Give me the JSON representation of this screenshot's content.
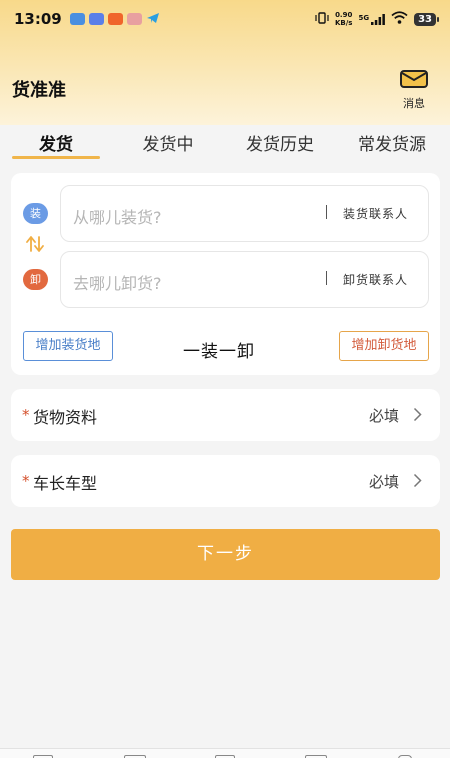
{
  "status_bar": {
    "time": "13:09",
    "net_speed_value": "0.90",
    "net_speed_unit": "KB/s",
    "network": "5G",
    "battery": "33"
  },
  "header": {
    "title": "货准准",
    "message_label": "消息"
  },
  "tabs": [
    {
      "label": "发货"
    },
    {
      "label": "发货中"
    },
    {
      "label": "发货历史"
    },
    {
      "label": "常发货源"
    }
  ],
  "route": {
    "load_badge": "装",
    "unload_badge": "卸",
    "load_placeholder": "从哪儿装货?",
    "load_contact": "装货联系人",
    "unload_placeholder": "去哪儿卸货?",
    "unload_contact": "卸货联系人",
    "add_load": "增加装货地",
    "add_unload": "增加卸货地",
    "mode": "一装一卸"
  },
  "rows": {
    "cargo": {
      "required": "*",
      "label": "货物资料",
      "value": "必填"
    },
    "truck": {
      "required": "*",
      "label": "车长车型",
      "value": "必填"
    }
  },
  "next_label": "下一步",
  "colors": {
    "accent": "#f0ae44",
    "load_blue": "#6b9be5",
    "unload_red": "#e2693f",
    "required_red": "#d4502c"
  }
}
